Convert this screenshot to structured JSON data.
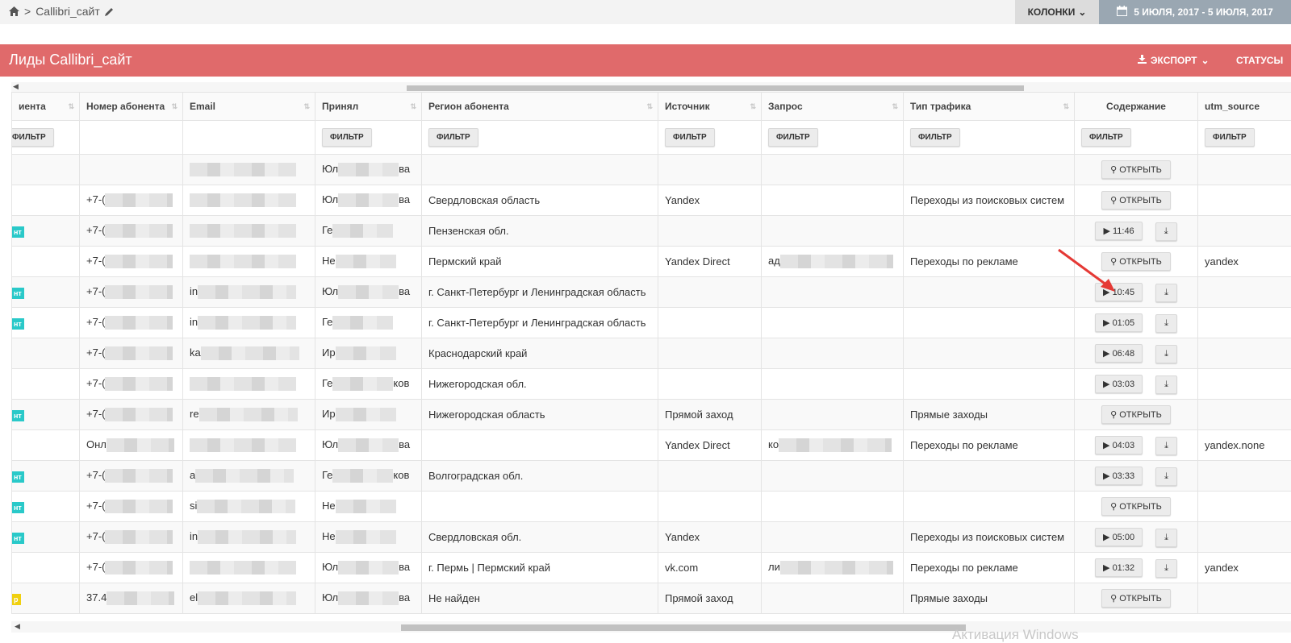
{
  "breadcrumb": {
    "home_icon": "home-icon",
    "separator": ">",
    "current": "Callibri_сайт",
    "edit_icon": "pencil-icon"
  },
  "toolbar": {
    "columns_label": "КОЛОНКИ",
    "date_range": "5 ИЮЛЯ, 2017 - 5 ИЮЛЯ, 2017"
  },
  "panel": {
    "title": "Лиды Callibri_сайт",
    "export_label": "ЭКСПОРТ",
    "statuses_label": "СТАТУСЫ",
    "accent_color": "#e06a6b"
  },
  "table": {
    "columns": [
      "иента",
      "Номер абонента",
      "Email",
      "Принял",
      "Регион абонента",
      "Источник",
      "Запрос",
      "Тип трафика",
      "Содержание",
      "utm_source"
    ],
    "filter_label": "ФИЛЬТР",
    "open_label": "ОТКРЫТЬ",
    "rows": [
      {
        "tag": "",
        "phone": "",
        "email": "",
        "accepted": "Юл",
        "accepted_end": "ва",
        "region": "",
        "source": "",
        "query": "",
        "traffic": "",
        "content": "open",
        "duration": "",
        "utm": ""
      },
      {
        "tag": "",
        "phone": "+7-(",
        "email": "",
        "accepted": "Юл",
        "accepted_end": "ва",
        "region": "Свердловская область",
        "source": "Yandex",
        "query": "",
        "traffic": "Переходы из поисковых систем",
        "content": "open",
        "duration": "",
        "utm": ""
      },
      {
        "tag": "нт",
        "phone": "+7-(",
        "email": "",
        "accepted": "Ге",
        "accepted_end": "",
        "region": "Пензенская обл.",
        "source": "",
        "query": "",
        "traffic": "",
        "content": "play",
        "duration": "11:46",
        "utm": ""
      },
      {
        "tag": "",
        "phone": "+7-(",
        "email": "",
        "accepted": "Не",
        "accepted_end": "",
        "region": "Пермский край",
        "source": "Yandex Direct",
        "query": "ад",
        "traffic": "Переходы по рекламе",
        "content": "open",
        "duration": "",
        "utm": "yandex"
      },
      {
        "tag": "нт",
        "phone": "+7-(",
        "email": "in",
        "accepted": "Юл",
        "accepted_end": "ва",
        "region": "г. Санкт-Петербург и Ленинградская область",
        "source": "",
        "query": "",
        "traffic": "",
        "content": "play",
        "duration": "10:45",
        "utm": ""
      },
      {
        "tag": "нт",
        "phone": "+7-(",
        "email": "in",
        "accepted": "Ге",
        "accepted_end": "",
        "region": "г. Санкт-Петербург и Ленинградская область",
        "source": "",
        "query": "",
        "traffic": "",
        "content": "play",
        "duration": "01:05",
        "utm": ""
      },
      {
        "tag": "",
        "phone": "+7-(",
        "email": "ka",
        "accepted": "Ир",
        "accepted_end": "",
        "region": "Краснодарский край",
        "source": "",
        "query": "",
        "traffic": "",
        "content": "play",
        "duration": "06:48",
        "utm": ""
      },
      {
        "tag": "",
        "phone": "+7-(",
        "email": "",
        "accepted": "Ге",
        "accepted_end": "ков",
        "region": "Нижегородская обл.",
        "source": "",
        "query": "",
        "traffic": "",
        "content": "play",
        "duration": "03:03",
        "utm": ""
      },
      {
        "tag": "нт",
        "phone": "+7-(",
        "email": "re",
        "accepted": "Ир",
        "accepted_end": "",
        "region": "Нижегородская область",
        "source": "Прямой заход",
        "query": "",
        "traffic": "Прямые заходы",
        "content": "open",
        "duration": "",
        "utm": ""
      },
      {
        "tag": "",
        "phone": "Онл",
        "email": "",
        "accepted": "Юл",
        "accepted_end": "ва",
        "region": "",
        "source": "Yandex Direct",
        "query": "ко",
        "traffic": "Переходы по рекламе",
        "content": "play",
        "duration": "04:03",
        "utm": "yandex.none"
      },
      {
        "tag": "нт",
        "phone": "+7-(",
        "email": "a",
        "accepted": "Ге",
        "accepted_end": "ков",
        "region": "Волгоградская обл.",
        "source": "",
        "query": "",
        "traffic": "",
        "content": "play",
        "duration": "03:33",
        "utm": ""
      },
      {
        "tag": "нт",
        "phone": "+7-(",
        "email": "si",
        "accepted": "Не",
        "accepted_end": "",
        "region": "",
        "source": "",
        "query": "",
        "traffic": "",
        "content": "open",
        "duration": "",
        "utm": ""
      },
      {
        "tag": "нт",
        "phone": "+7-(",
        "email": "in",
        "accepted": "Не",
        "accepted_end": "",
        "region": "Свердловская обл.",
        "source": "Yandex",
        "query": "",
        "traffic": "Переходы из поисковых систем",
        "content": "play",
        "duration": "05:00",
        "utm": ""
      },
      {
        "tag": "",
        "phone": "+7-(",
        "email": "",
        "accepted": "Юл",
        "accepted_end": "ва",
        "region": "г. Пермь | Пермский край",
        "source": "vk.com",
        "query": "ли",
        "traffic": "Переходы по рекламе",
        "content": "play",
        "duration": "01:32",
        "utm": "yandex"
      },
      {
        "tag": "р",
        "phone": "37.4",
        "email": "el",
        "accepted": "Юл",
        "accepted_end": "ва",
        "region": "Не найден",
        "source": "Прямой заход",
        "query": "",
        "traffic": "Прямые заходы",
        "content": "open",
        "duration": "",
        "utm": ""
      }
    ]
  },
  "watermark": "Активация Windows",
  "colors": {
    "tag_teal": "#2ac9c9",
    "tag_yellow": "#f0d010",
    "date_button": "#9aa7b2",
    "annotation_arrow": "#e53935"
  }
}
